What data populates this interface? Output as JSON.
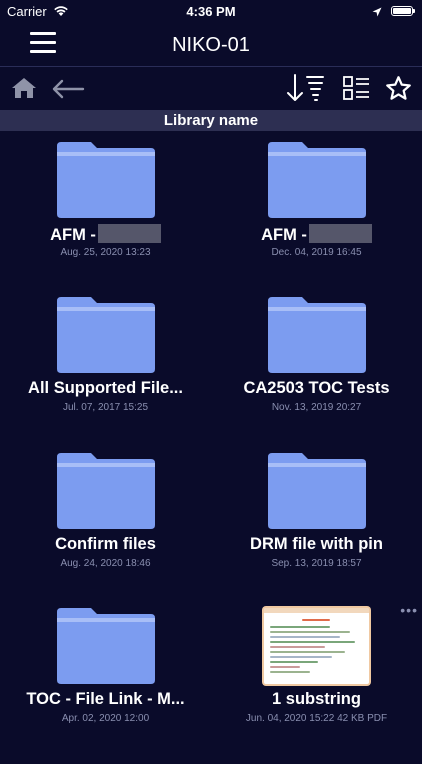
{
  "status_bar": {
    "carrier": "Carrier",
    "time": "4:36 PM",
    "battery_level": 1.0
  },
  "nav": {
    "title": "NIKO-01",
    "menu_icon": "hamburger-menu-icon"
  },
  "toolbar": {
    "home_icon": "home-icon",
    "back_icon": "back-arrow-icon",
    "sort_icon": "sort-icon",
    "view_icon": "list-view-icon",
    "favorite_icon": "star-icon"
  },
  "section": {
    "title": "Library name"
  },
  "colors": {
    "background": "#0a0b2a",
    "folder": "#7c9cf0",
    "folder_tab": "#a8bef7",
    "header_band": "#2d2f52",
    "subtext": "#8a8fb0"
  },
  "items": [
    {
      "name": "AFM -",
      "date": "Aug. 25, 2020 13:23",
      "type": "folder",
      "redacted_suffix": true
    },
    {
      "name": "AFM -",
      "date": "Dec. 04, 2019 16:45",
      "type": "folder",
      "redacted_suffix": true
    },
    {
      "name": "All Supported File...",
      "date": "Jul. 07, 2017 15:25",
      "type": "folder"
    },
    {
      "name": "CA2503 TOC Tests",
      "date": "Nov. 13, 2019 20:27",
      "type": "folder"
    },
    {
      "name": "Confirm files",
      "date": "Aug. 24, 2020 18:46",
      "type": "folder"
    },
    {
      "name": "DRM file with pin",
      "date": "Sep. 13, 2019 18:57",
      "type": "folder"
    },
    {
      "name": "TOC - File Link - M...",
      "date": "Apr. 02, 2020 12:00",
      "type": "folder"
    },
    {
      "name": "1 substring",
      "date": "Jun. 04, 2020 15:22 42 KB PDF",
      "type": "document",
      "more_label": "•••"
    }
  ]
}
